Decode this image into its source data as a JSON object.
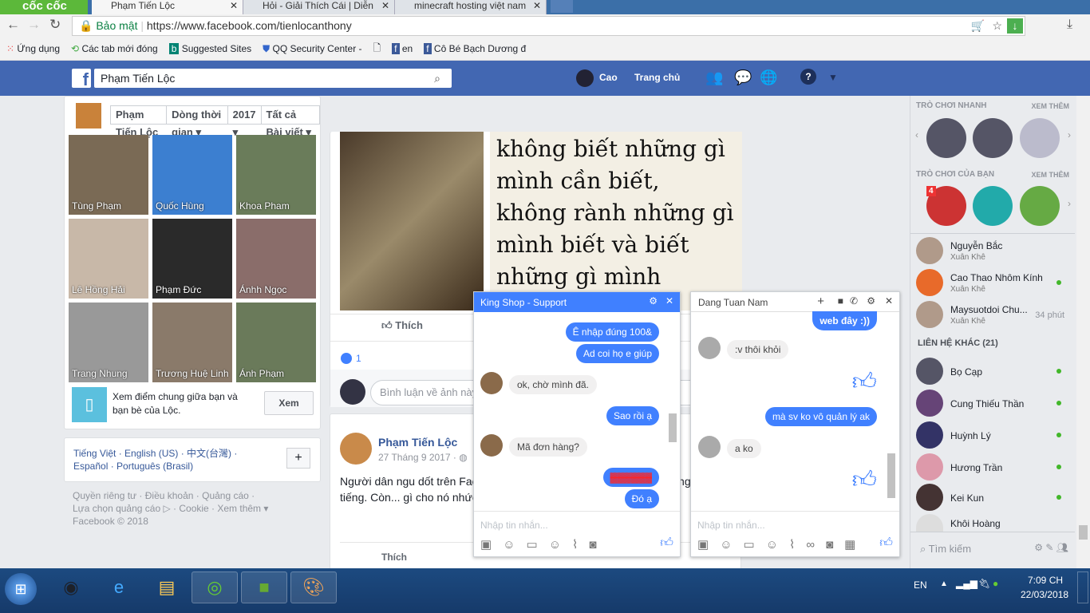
{
  "browser": {
    "logo": "cốc cốc",
    "tabs": [
      {
        "title": "Phạm Tiến Lộc"
      },
      {
        "title": "Hỏi - Giải Thích Cái | Diễn"
      },
      {
        "title": "minecraft hosting việt nam"
      }
    ],
    "secure_label": "Bảo mật",
    "url": "https://www.facebook.com/tienlocanthony",
    "bookmarks": [
      "Ứng dụng",
      "Các tab mới đóng",
      "Suggested Sites",
      "QQ Security Center -",
      "",
      "en",
      "Cô Bé Bạch Dương đ"
    ]
  },
  "fb": {
    "search_value": "Phạm Tiến Lộc",
    "user": "Cao",
    "home": "Trang chủ"
  },
  "timeline": {
    "name": "Phạm Tiến Lộc",
    "nav": "Dòng thời gian",
    "year": "2017",
    "filter": "Tất cả Bài viết"
  },
  "friends": [
    "Tùng Phạm",
    "Quốc Hùng",
    "Khoa Pham",
    "Lê Hồng Hải",
    "Phạm Đức",
    "Ánhh Ngọc",
    "Trang Nhung",
    "Trương Huệ Linh",
    "Ánh Phạm"
  ],
  "compare": {
    "text": "Xem điểm chung giữa bạn và bạn bè của Lộc.",
    "button": "Xem"
  },
  "languages": {
    "text": "Tiếng Việt · English (US) · 中文(台灣) · Español · Português (Brasil)",
    "add": "+"
  },
  "footer": [
    "Quyền riêng tư · Điều khoản · Quảng cáo ·",
    "Lựa chọn quảng cáo ▷ · Cookie · Xem thêm ▾",
    "Facebook © 2018"
  ],
  "post1": {
    "image_text": "không biết những gì mình cần biết, không rành những gì mình biết và biết những gì mình không cần biết.",
    "like": "Thích",
    "like_count": "1",
    "comment_placeholder": "Bình luận về ảnh này..."
  },
  "post2": {
    "author": "Phạm Tiến Lộc",
    "date": "27 Tháng 9 2017 ·",
    "text": "Người dân ngu dốt trên Fac... hay khoe mông của mấy em... những người nổi tiếng. Còn... gì cho nó nhức não...😠",
    "like": "Thích"
  },
  "chat1": {
    "title": "King Shop - Support",
    "messages": [
      {
        "from": "me",
        "text": "Ê nhập đúng 100&"
      },
      {
        "from": "me",
        "text": "Ad coi họ e giúp"
      },
      {
        "from": "them",
        "text": "ok, chờ mình đã."
      },
      {
        "from": "me",
        "text": "Sao rồi ạ"
      },
      {
        "from": "them",
        "text": "Mã đơn hàng?"
      },
      {
        "from": "me",
        "text": "(scribbled)"
      },
      {
        "from": "me",
        "text": "Đó ạ"
      }
    ],
    "placeholder": "Nhập tin nhắn..."
  },
  "chat2": {
    "title": "Dang Tuan Nam",
    "messages": [
      {
        "from": "me",
        "text": "web đây :))"
      },
      {
        "from": "them",
        "text": ":v thôi khỏi"
      },
      {
        "from": "me",
        "text": "mà sv ko vô quản lý ak"
      },
      {
        "from": "them",
        "text": "a ko"
      }
    ],
    "placeholder": "Nhập tin nhắn..."
  },
  "sidebar": {
    "quick_games": "TRÒ CHƠI NHANH",
    "your_games": "TRÒ CHƠI CỦA BẠN",
    "see_more": "XEM THÊM",
    "badge": "4",
    "suggested": [
      {
        "name": "Nguyễn Bắc",
        "sub": "Xuân Khê"
      },
      {
        "name": "Cao Thao Nhôm Kính",
        "sub": "Xuân Khê",
        "online": true
      },
      {
        "name": "Maysuotdoi Chu...",
        "sub": "Xuân Khê",
        "time": "34 phút"
      }
    ],
    "other_contacts": "LIÊN HỆ KHÁC (21)",
    "contacts": [
      "Bọ Cạp",
      "Cung Thiếu Thần",
      "Huỳnh Lý",
      "Hương Trần",
      "Kei Kun",
      "Khôi Hoàng"
    ],
    "search_placeholder": "Tìm kiếm"
  },
  "taskbar": {
    "lang": "EN",
    "time": "7:09 CH",
    "date": "22/03/2018"
  }
}
